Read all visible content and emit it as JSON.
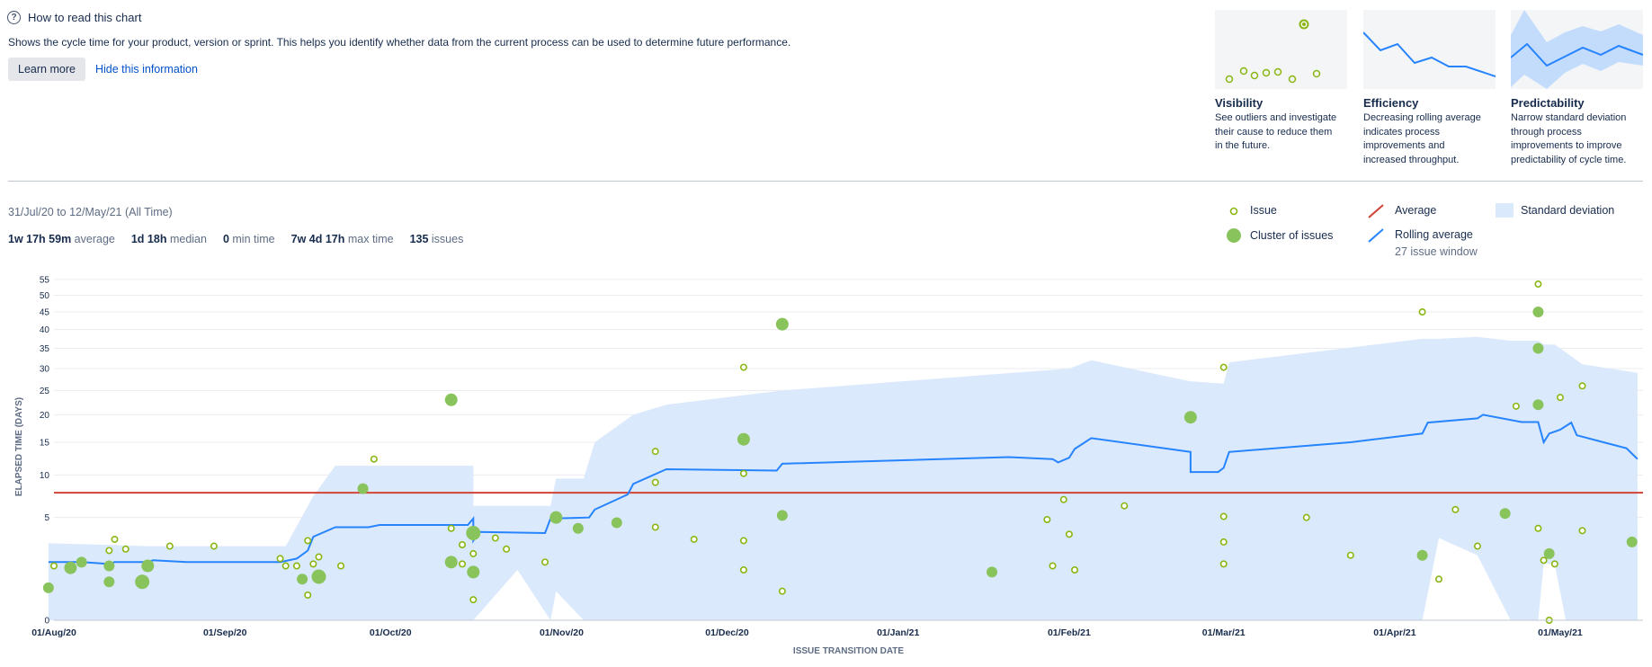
{
  "help": {
    "title": "How to read this chart",
    "description": "Shows the cycle time for your product, version or sprint. This helps you identify whether data from the current process can be used to determine future performance.",
    "learn_more": "Learn more",
    "hide": "Hide this information"
  },
  "cards": [
    {
      "title": "Visibility",
      "lines": [
        "See outliers and investigate",
        "their cause to reduce them",
        "in the future."
      ]
    },
    {
      "title": "Efficiency",
      "lines": [
        "Decreasing rolling average",
        "indicates process",
        "improvements and",
        "increased throughput."
      ]
    },
    {
      "title": "Predictability",
      "lines": [
        "Narrow standard deviation",
        "through process",
        "improvements to improve",
        "predictability of cycle time."
      ]
    }
  ],
  "summary": {
    "range": "31/Jul/20 to 12/May/21 (All Time)",
    "stats": [
      {
        "value": "1w 17h 59m",
        "label": "average"
      },
      {
        "value": "1d 18h",
        "label": "median"
      },
      {
        "value": "0",
        "label": "min time"
      },
      {
        "value": "7w 4d 17h",
        "label": "max time"
      },
      {
        "value": "135",
        "label": "issues"
      }
    ]
  },
  "legend": {
    "issue": "Issue",
    "cluster": "Cluster of issues",
    "average": "Average",
    "rolling": "Rolling average",
    "rolling_window": "27 issue window",
    "stddev": "Standard deviation"
  },
  "colors": {
    "issue": "#8ab613",
    "cluster": "#89c35c",
    "average": "#d04437",
    "rolling": "#2684ff",
    "stddev": "#dbe9fc",
    "link": "#0052cc"
  },
  "chart_data": {
    "type": "scatter",
    "xlabel": "ISSUE TRANSITION DATE",
    "ylabel": "ELAPSED TIME (DAYS)",
    "xlim": [
      "2020-08-01",
      "2021-05-16"
    ],
    "x_ticks": [
      {
        "date": "2020-08-01",
        "label": "01/Aug/20"
      },
      {
        "date": "2020-09-01",
        "label": "01/Sep/20"
      },
      {
        "date": "2020-10-01",
        "label": "01/Oct/20"
      },
      {
        "date": "2020-11-01",
        "label": "01/Nov/20"
      },
      {
        "date": "2020-12-01",
        "label": "01/Dec/20"
      },
      {
        "date": "2021-01-01",
        "label": "01/Jan/21"
      },
      {
        "date": "2021-02-01",
        "label": "01/Feb/21"
      },
      {
        "date": "2021-03-01",
        "label": "01/Mar/21"
      },
      {
        "date": "2021-04-01",
        "label": "01/Apr/21"
      },
      {
        "date": "2021-05-01",
        "label": "01/May/21"
      }
    ],
    "y_scale": "sqrt",
    "ylim": [
      0,
      57
    ],
    "y_ticks": [
      0,
      5,
      10,
      15,
      20,
      25,
      30,
      35,
      40,
      45,
      50,
      55
    ],
    "grid": true,
    "average": 7.7,
    "issues": [
      [
        "2020-08-01",
        1.4
      ],
      [
        "2020-08-11",
        2.3
      ],
      [
        "2020-08-12",
        3.1
      ],
      [
        "2020-08-14",
        2.4
      ],
      [
        "2020-08-22",
        2.6
      ],
      [
        "2020-08-30",
        2.6
      ],
      [
        "2020-09-11",
        1.8
      ],
      [
        "2020-09-12",
        1.4
      ],
      [
        "2020-09-14",
        1.4
      ],
      [
        "2020-09-16",
        0.3
      ],
      [
        "2020-09-16",
        3.0
      ],
      [
        "2020-09-17",
        1.5
      ],
      [
        "2020-09-18",
        1.9
      ],
      [
        "2020-09-22",
        1.4
      ],
      [
        "2020-09-28",
        12.3
      ],
      [
        "2020-10-12",
        4.0
      ],
      [
        "2020-10-14",
        2.7
      ],
      [
        "2020-10-14",
        1.5
      ],
      [
        "2020-10-16",
        2.1
      ],
      [
        "2020-10-16",
        0.2
      ],
      [
        "2020-10-20",
        3.2
      ],
      [
        "2020-10-22",
        2.4
      ],
      [
        "2020-10-29",
        1.6
      ],
      [
        "2020-11-18",
        13.5
      ],
      [
        "2020-11-18",
        9.0
      ],
      [
        "2020-11-18",
        4.1
      ],
      [
        "2020-11-25",
        3.1
      ],
      [
        "2020-12-04",
        30.3
      ],
      [
        "2020-12-04",
        10.2
      ],
      [
        "2020-12-04",
        3.0
      ],
      [
        "2020-12-04",
        1.2
      ],
      [
        "2020-12-11",
        0.4
      ],
      [
        "2021-01-28",
        4.8
      ],
      [
        "2021-01-29",
        1.4
      ],
      [
        "2021-01-31",
        6.9
      ],
      [
        "2021-02-01",
        3.5
      ],
      [
        "2021-02-02",
        1.2
      ],
      [
        "2021-02-11",
        6.2
      ],
      [
        "2021-03-01",
        30.3
      ],
      [
        "2021-03-01",
        5.1
      ],
      [
        "2021-03-01",
        2.9
      ],
      [
        "2021-03-01",
        1.5
      ],
      [
        "2021-03-16",
        5.0
      ],
      [
        "2021-03-24",
        2.0
      ],
      [
        "2021-04-06",
        45.0
      ],
      [
        "2021-04-09",
        0.8
      ],
      [
        "2021-04-12",
        5.8
      ],
      [
        "2021-04-16",
        2.6
      ],
      [
        "2021-04-23",
        21.7
      ],
      [
        "2021-04-27",
        53.5
      ],
      [
        "2021-04-27",
        4.0
      ],
      [
        "2021-04-28",
        1.7
      ],
      [
        "2021-04-29",
        0.0
      ],
      [
        "2021-04-30",
        1.5
      ],
      [
        "2021-05-01",
        23.5
      ],
      [
        "2021-05-05",
        26.0
      ],
      [
        "2021-05-05",
        3.8
      ]
    ],
    "clusters": [
      [
        "2020-07-31",
        0.5,
        6
      ],
      [
        "2020-08-04",
        1.3,
        7
      ],
      [
        "2020-08-06",
        1.6,
        6
      ],
      [
        "2020-08-11",
        1.4,
        6
      ],
      [
        "2020-08-11",
        0.7,
        6
      ],
      [
        "2020-08-17",
        0.7,
        8
      ],
      [
        "2020-08-18",
        1.4,
        7
      ],
      [
        "2020-09-15",
        0.8,
        6
      ],
      [
        "2020-09-18",
        0.9,
        8
      ],
      [
        "2020-09-26",
        8.2,
        6
      ],
      [
        "2020-10-12",
        23.0,
        7
      ],
      [
        "2020-10-12",
        1.6,
        7
      ],
      [
        "2020-10-16",
        3.6,
        8
      ],
      [
        "2020-10-16",
        1.1,
        7
      ],
      [
        "2020-10-31",
        5.0,
        7
      ],
      [
        "2020-11-04",
        4.0,
        6
      ],
      [
        "2020-11-11",
        4.5,
        6
      ],
      [
        "2020-12-04",
        15.5,
        7
      ],
      [
        "2020-12-11",
        5.2,
        6
      ],
      [
        "2020-12-11",
        41.5,
        7
      ],
      [
        "2021-01-18",
        1.1,
        6
      ],
      [
        "2021-02-23",
        19.5,
        7
      ],
      [
        "2021-04-06",
        2.0,
        6
      ],
      [
        "2021-04-21",
        5.4,
        6
      ],
      [
        "2021-04-27",
        45.0,
        6
      ],
      [
        "2021-04-27",
        35.0,
        6
      ],
      [
        "2021-04-27",
        22.0,
        6
      ],
      [
        "2021-04-29",
        2.1,
        6
      ],
      [
        "2021-05-14",
        2.9,
        6
      ]
    ],
    "rolling_average": [
      [
        "2020-07-31",
        1.6
      ],
      [
        "2020-08-06",
        1.6
      ],
      [
        "2020-08-11",
        1.5
      ],
      [
        "2020-08-12",
        1.6
      ],
      [
        "2020-08-18",
        1.6
      ],
      [
        "2020-08-19",
        1.7
      ],
      [
        "2020-08-25",
        1.6
      ],
      [
        "2020-09-11",
        1.6
      ],
      [
        "2020-09-14",
        1.8
      ],
      [
        "2020-09-16",
        2.3
      ],
      [
        "2020-09-17",
        3.3
      ],
      [
        "2020-09-21",
        4.1
      ],
      [
        "2020-09-27",
        4.1
      ],
      [
        "2020-09-29",
        4.3
      ],
      [
        "2020-10-15",
        4.3
      ],
      [
        "2020-10-16",
        4.9
      ],
      [
        "2020-10-16",
        3.0
      ],
      [
        "2020-10-17",
        3.7
      ],
      [
        "2020-10-29",
        3.6
      ],
      [
        "2020-10-30",
        4.9
      ],
      [
        "2020-11-06",
        5.0
      ],
      [
        "2020-11-07",
        5.8
      ],
      [
        "2020-11-13",
        7.5
      ],
      [
        "2020-11-14",
        8.8
      ],
      [
        "2020-11-20",
        10.8
      ],
      [
        "2020-12-10",
        10.6
      ],
      [
        "2020-12-11",
        11.6
      ],
      [
        "2021-01-21",
        12.6
      ],
      [
        "2021-01-29",
        12.3
      ],
      [
        "2021-01-30",
        11.8
      ],
      [
        "2021-02-01",
        12.5
      ],
      [
        "2021-02-02",
        13.9
      ],
      [
        "2021-02-05",
        15.7
      ],
      [
        "2021-02-23",
        13.4
      ],
      [
        "2021-02-23",
        10.4
      ],
      [
        "2021-02-28",
        10.4
      ],
      [
        "2021-03-01",
        11.0
      ],
      [
        "2021-03-02",
        13.4
      ],
      [
        "2021-03-24",
        15.0
      ],
      [
        "2021-04-06",
        16.5
      ],
      [
        "2021-04-07",
        18.5
      ],
      [
        "2021-04-16",
        19.3
      ],
      [
        "2021-04-17",
        20.0
      ],
      [
        "2021-04-24",
        18.6
      ],
      [
        "2021-04-27",
        18.6
      ],
      [
        "2021-04-28",
        15.0
      ],
      [
        "2021-04-29",
        16.5
      ],
      [
        "2021-05-01",
        17.2
      ],
      [
        "2021-05-03",
        18.5
      ],
      [
        "2021-05-04",
        16.2
      ],
      [
        "2021-05-13",
        14.0
      ],
      [
        "2021-05-15",
        12.3
      ]
    ],
    "std_dev_band": [
      [
        "2020-07-31",
        0.0,
        2.8
      ],
      [
        "2020-08-10",
        0.0,
        2.7
      ],
      [
        "2020-08-18",
        0.0,
        2.6
      ],
      [
        "2020-09-12",
        0.0,
        2.6
      ],
      [
        "2020-09-17",
        0.0,
        7.3
      ],
      [
        "2020-09-21",
        0.0,
        11.3
      ],
      [
        "2020-10-16",
        0.0,
        11.3
      ],
      [
        "2020-10-16",
        0.0,
        6.2
      ],
      [
        "2020-10-24",
        1.2,
        6.2
      ],
      [
        "2020-10-30",
        0.0,
        6.2
      ],
      [
        "2020-10-31",
        0.4,
        9.5
      ],
      [
        "2020-11-05",
        0.0,
        9.5
      ],
      [
        "2020-11-07",
        0.0,
        15.0
      ],
      [
        "2020-11-14",
        0.0,
        20.0
      ],
      [
        "2020-11-20",
        0.0,
        22.0
      ],
      [
        "2020-12-11",
        0.0,
        25.0
      ],
      [
        "2021-02-01",
        0.0,
        30.0
      ],
      [
        "2021-02-05",
        0.0,
        32.0
      ],
      [
        "2021-02-23",
        0.0,
        27.0
      ],
      [
        "2021-03-01",
        0.0,
        26.5
      ],
      [
        "2021-03-02",
        0.0,
        31.5
      ],
      [
        "2021-04-06",
        0.0,
        37.5
      ],
      [
        "2021-04-09",
        3.2,
        37.5
      ],
      [
        "2021-04-16",
        2.0,
        38.0
      ],
      [
        "2021-04-22",
        0.0,
        37.0
      ],
      [
        "2021-04-27",
        0.0,
        37.0
      ],
      [
        "2021-04-28",
        1.5,
        36.0
      ],
      [
        "2021-04-30",
        1.5,
        36.0
      ],
      [
        "2021-05-02",
        0.0,
        34.0
      ],
      [
        "2021-05-05",
        0.0,
        31.0
      ],
      [
        "2021-05-15",
        0.0,
        29.0
      ]
    ]
  }
}
